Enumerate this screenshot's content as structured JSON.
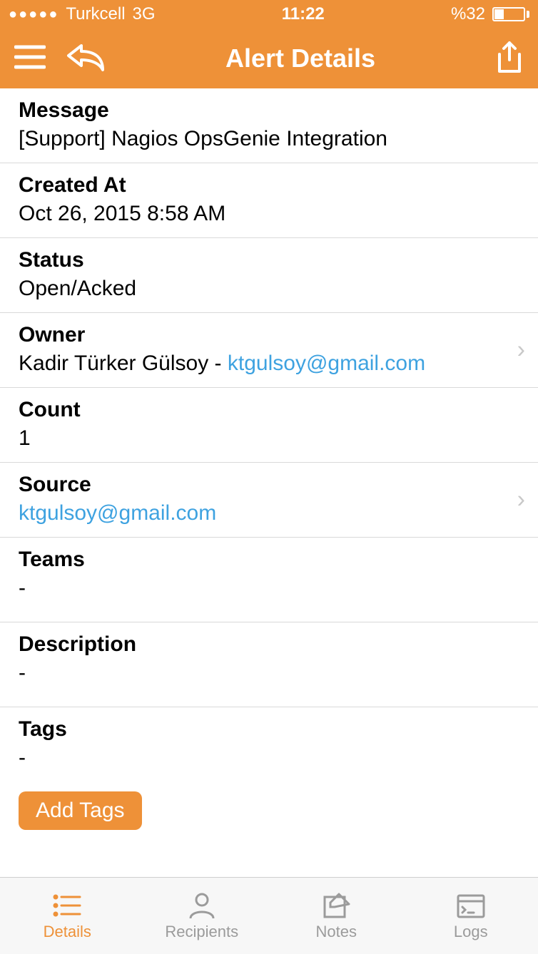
{
  "colors": {
    "accent": "#ee9138",
    "link": "#3ea2e0"
  },
  "status_bar": {
    "carrier": "Turkcell",
    "network": "3G",
    "time": "11:22",
    "battery_text": "%32"
  },
  "nav": {
    "title": "Alert Details"
  },
  "rows": {
    "message": {
      "label": "Message",
      "value": "[Support] Nagios OpsGenie Integration"
    },
    "created_at": {
      "label": "Created At",
      "value": "Oct 26, 2015 8:58 AM"
    },
    "status": {
      "label": "Status",
      "value": "Open/Acked"
    },
    "owner": {
      "label": "Owner",
      "name": "Kadir Türker Gülsoy",
      "separator": " - ",
      "email": "ktgulsoy@gmail.com"
    },
    "count": {
      "label": "Count",
      "value": "1"
    },
    "source": {
      "label": "Source",
      "value": "ktgulsoy@gmail.com"
    },
    "teams": {
      "label": "Teams",
      "value": "-"
    },
    "description": {
      "label": "Description",
      "value": "-"
    },
    "tags": {
      "label": "Tags",
      "value": "-"
    }
  },
  "buttons": {
    "add_tags": "Add Tags"
  },
  "tabs": {
    "details": "Details",
    "recipients": "Recipients",
    "notes": "Notes",
    "logs": "Logs"
  }
}
